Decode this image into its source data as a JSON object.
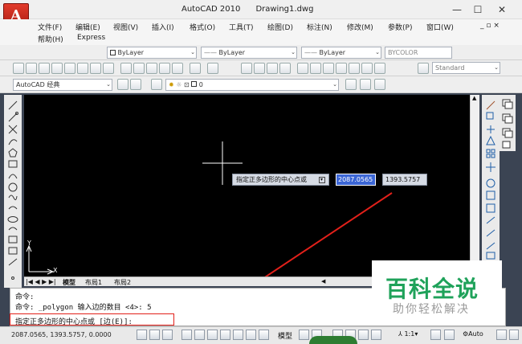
{
  "window": {
    "title": "AutoCAD 2010      Drawing1.dwg",
    "app_button_label": "A",
    "minimize": "—",
    "maximize": "☐",
    "close": "✕"
  },
  "menubar": {
    "items": [
      "文件(F)",
      "编辑(E)",
      "视图(V)",
      "插入(I)",
      "格式(O)",
      "工具(T)",
      "绘图(D)",
      "标注(N)",
      "修改(M)",
      "参数(P)",
      "窗口(W)"
    ],
    "items_row2": [
      "帮助(H)",
      "Express"
    ]
  },
  "properties_toolbar": {
    "layer_color": "ByLayer",
    "linetype": "ByLayer",
    "lineweight": "ByLayer",
    "plotstyle": "BYCOLOR"
  },
  "workspace": {
    "name": "AutoCAD 经典",
    "layer_value": "0",
    "text_style": "Standard"
  },
  "layout_tabs": [
    "模型",
    "布局1",
    "布局2"
  ],
  "ucs": {
    "x": "X",
    "y": "Y"
  },
  "dynamic_input": {
    "prompt": "指定正多边形的中心点或",
    "x_value": "2087.0565",
    "y_value": "1393.5757"
  },
  "command_window": {
    "lines": [
      "命令:",
      "命令: _polygon 输入边的数目 <4>: 5"
    ],
    "current_prompt": "指定正多边形的中心点或 [边(E)]:"
  },
  "statusbar": {
    "coordinates": "2087.0565, 1393.5757, 0.0000",
    "model_label": "模型",
    "annotation_scale": "1:1",
    "auto_label": "Auto"
  },
  "watermark": {
    "title": "百科全说",
    "subtitle": "助你轻松解决"
  },
  "colors": {
    "canvas": "#000000",
    "accent_red": "#e2201a",
    "watermark_green": "#1fa25a",
    "input_highlight": "#3b66d6"
  }
}
